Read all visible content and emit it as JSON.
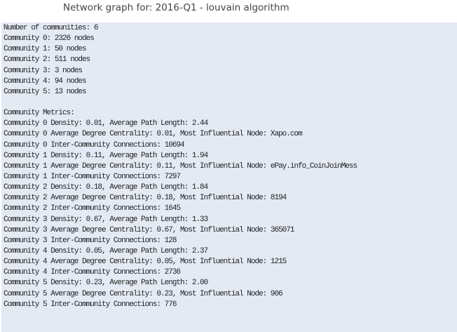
{
  "title": "Network graph for: 2016-Q1 - louvain algorithm",
  "output_lines": [
    "Number of communities: 6",
    "Community 0: 2326 nodes",
    "Community 1: 50 nodes",
    "Community 2: 511 nodes",
    "Community 3: 3 nodes",
    "Community 4: 94 nodes",
    "Community 5: 13 nodes",
    "",
    "Community Metrics:",
    "Community 0 Density: 0.01, Average Path Length: 2.44",
    "Community 0 Average Degree Centrality: 0.01, Most Influential Node: Xapo.com",
    "Community 0 Inter-Community Connections: 10694",
    "Community 1 Density: 0.11, Average Path Length: 1.94",
    "Community 1 Average Degree Centrality: 0.11, Most Influential Node: ePay.info_CoinJoinMess",
    "Community 1 Inter-Community Connections: 7297",
    "Community 2 Density: 0.18, Average Path Length: 1.84",
    "Community 2 Average Degree Centrality: 0.18, Most Influential Node: 8194",
    "Community 2 Inter-Community Connections: 1645",
    "Community 3 Density: 0.67, Average Path Length: 1.33",
    "Community 3 Average Degree Centrality: 0.67, Most Influential Node: 365071",
    "Community 3 Inter-Community Connections: 128",
    "Community 4 Density: 0.05, Average Path Length: 2.37",
    "Community 4 Average Degree Centrality: 0.05, Most Influential Node: 1215",
    "Community 4 Inter-Community Connections: 2736",
    "Community 5 Density: 0.23, Average Path Length: 2.00",
    "Community 5 Average Degree Centrality: 0.23, Most Influential Node: 906",
    "Community 5 Inter-Community Connections: 776"
  ]
}
